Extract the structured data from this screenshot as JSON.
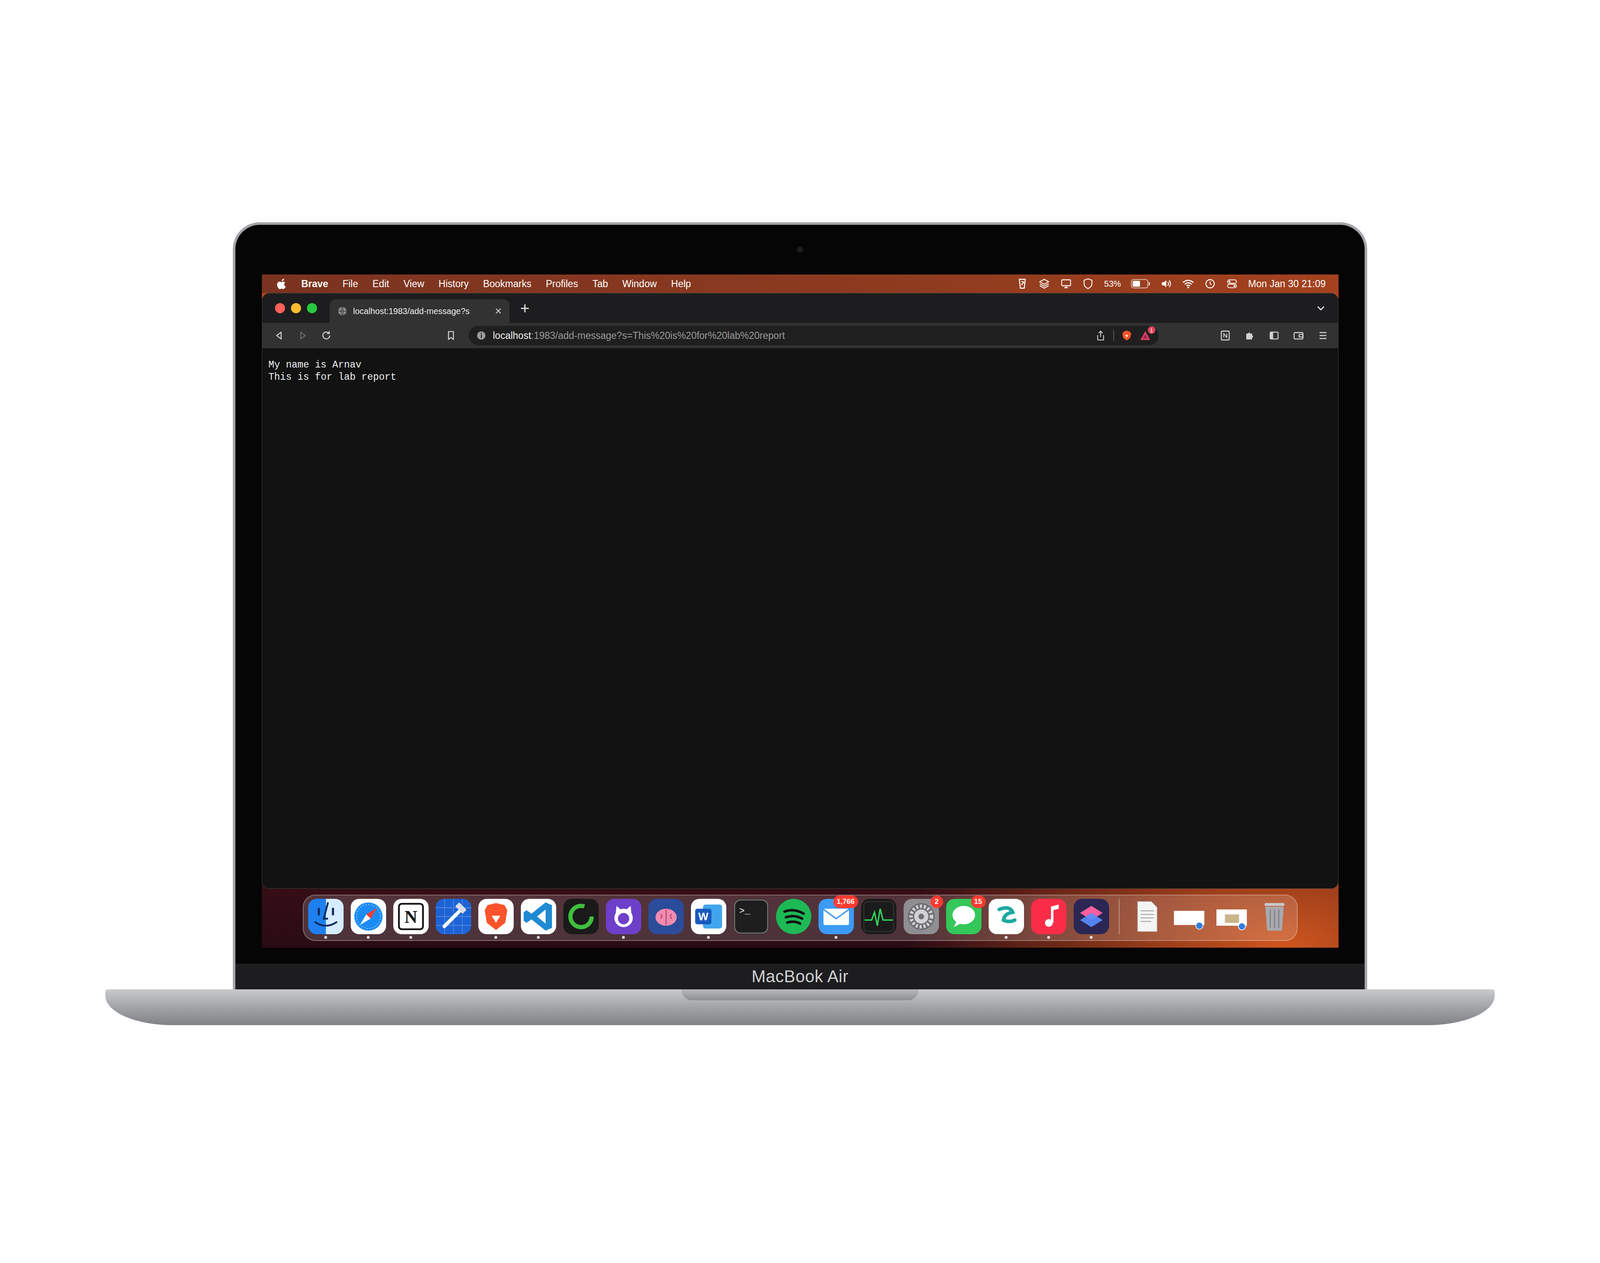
{
  "menubar": {
    "app": "Brave",
    "menus": [
      "File",
      "Edit",
      "View",
      "History",
      "Bookmarks",
      "Profiles",
      "Tab",
      "Window",
      "Help"
    ],
    "battery": {
      "reading": "53%",
      "level": 0.53
    },
    "clock": "Mon Jan 30 21:09"
  },
  "tabs": [
    {
      "title": "localhost:1983/add-message?s",
      "selected": true,
      "close": "×"
    }
  ],
  "new_tab": "+",
  "nav": {
    "back_disabled": false,
    "forward_disabled": true
  },
  "address_bar": {
    "host": "localhost",
    "path": ":1983/add-message?s=This%20is%20for%20lab%20report",
    "rewards_badge": "1"
  },
  "page": {
    "lines": [
      "My name is Arnav",
      "This is for lab report"
    ]
  },
  "dock": {
    "apps": [
      {
        "kind": "finder",
        "color": "#1e7ff0",
        "running": true,
        "badge": "",
        "mark": ""
      },
      {
        "kind": "safari",
        "color": "#ffffff",
        "running": true,
        "badge": "",
        "mark": ""
      },
      {
        "kind": "notion",
        "color": "#ffffff",
        "running": true,
        "badge": "",
        "mark": "N"
      },
      {
        "kind": "xcode",
        "color": "#1d63d6",
        "running": false,
        "badge": "",
        "mark": ""
      },
      {
        "kind": "brave",
        "color": "#ffffff",
        "running": true,
        "badge": "",
        "mark": ""
      },
      {
        "kind": "vscode",
        "color": "#ffffff",
        "running": true,
        "badge": "",
        "mark": ""
      },
      {
        "kind": "ring",
        "color": "#1a1a1a",
        "running": false,
        "badge": "",
        "mark": ""
      },
      {
        "kind": "github",
        "color": "#6e40c9",
        "running": true,
        "badge": "",
        "mark": ""
      },
      {
        "kind": "brain",
        "color": "#2b4c9a",
        "running": false,
        "badge": "",
        "mark": ""
      },
      {
        "kind": "word",
        "color": "#ffffff",
        "running": true,
        "badge": "",
        "mark": "W"
      },
      {
        "kind": "terminal",
        "color": "#1e1e1e",
        "running": false,
        "badge": "",
        "mark": ">_"
      },
      {
        "kind": "spotify",
        "color": "#1db954",
        "running": false,
        "badge": "",
        "mark": ""
      },
      {
        "kind": "mail",
        "color": "#3c9bf5",
        "running": true,
        "badge": "1,766",
        "mark": ""
      },
      {
        "kind": "activity",
        "color": "#1b1b1b",
        "running": false,
        "badge": "",
        "mark": ""
      },
      {
        "kind": "settings",
        "color": "#8e8e93",
        "running": false,
        "badge": "2",
        "mark": ""
      },
      {
        "kind": "messages",
        "color": "#34c759",
        "running": false,
        "badge": "15",
        "mark": ""
      },
      {
        "kind": "surfshark",
        "color": "#ffffff",
        "running": true,
        "badge": "",
        "mark": ""
      },
      {
        "kind": "music",
        "color": "#fa2d48",
        "running": true,
        "badge": "",
        "mark": ""
      },
      {
        "kind": "shortcuts",
        "color": "#2b2654",
        "running": true,
        "badge": "",
        "mark": ""
      }
    ]
  },
  "device": {
    "label": "MacBook Air"
  }
}
